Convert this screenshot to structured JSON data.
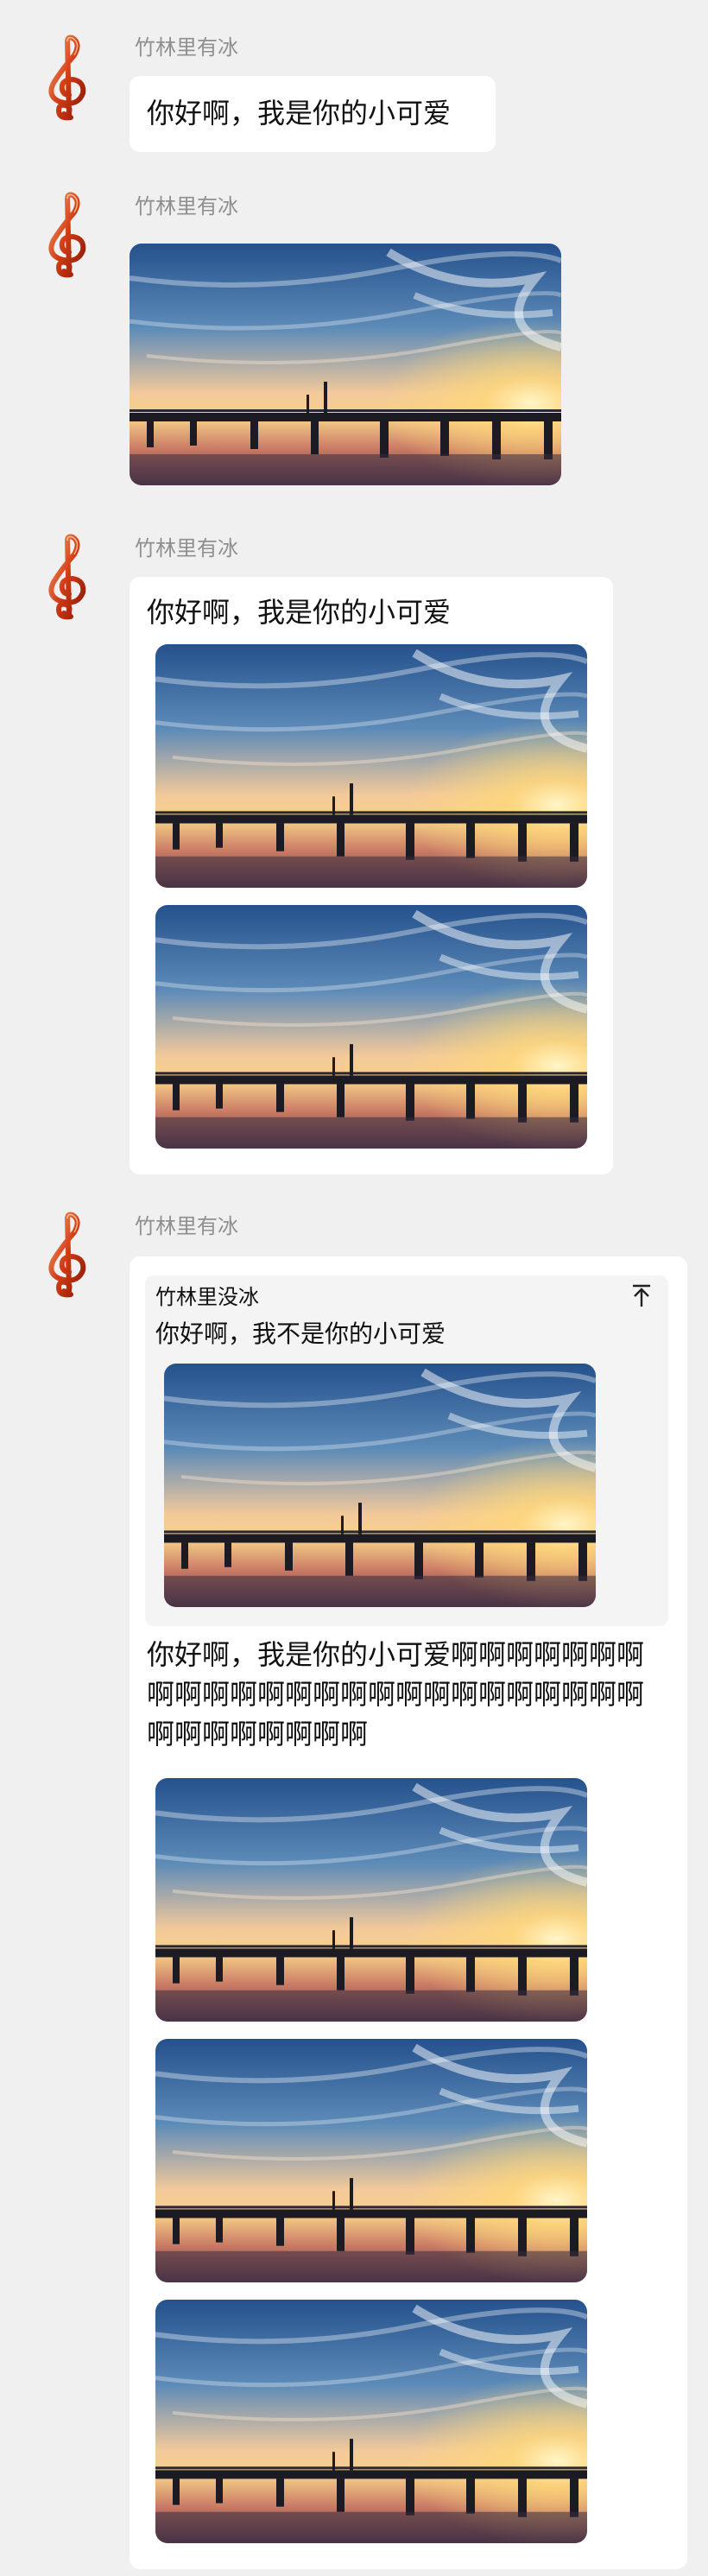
{
  "contact": {
    "name": "竹林里有冰"
  },
  "messages": [
    {
      "type": "text",
      "text": "你好啊，我是你的小可爱"
    },
    {
      "type": "image"
    },
    {
      "type": "text-images",
      "text": "你好啊，我是你的小可爱",
      "image_count": 2
    },
    {
      "type": "reply",
      "quote": {
        "sender": "竹林里没冰",
        "text": "你好啊，我不是你的小可爱",
        "image_count": 1
      },
      "text": "你好啊，我是你的小可爱啊啊啊啊啊啊啊啊啊啊啊啊啊啊啊啊啊啊啊啊啊啊啊啊啊啊啊啊啊啊啊啊啊",
      "image_count": 3
    }
  ],
  "icons": {
    "avatar": "treble-clef-icon",
    "pin": "pin-to-top-icon"
  },
  "colors": {
    "background": "#f0f0f0",
    "bubble": "#ffffff",
    "sender": "#8f8f8f",
    "quote_bg": "#f4f4f4",
    "avatar": "#d23b14"
  }
}
